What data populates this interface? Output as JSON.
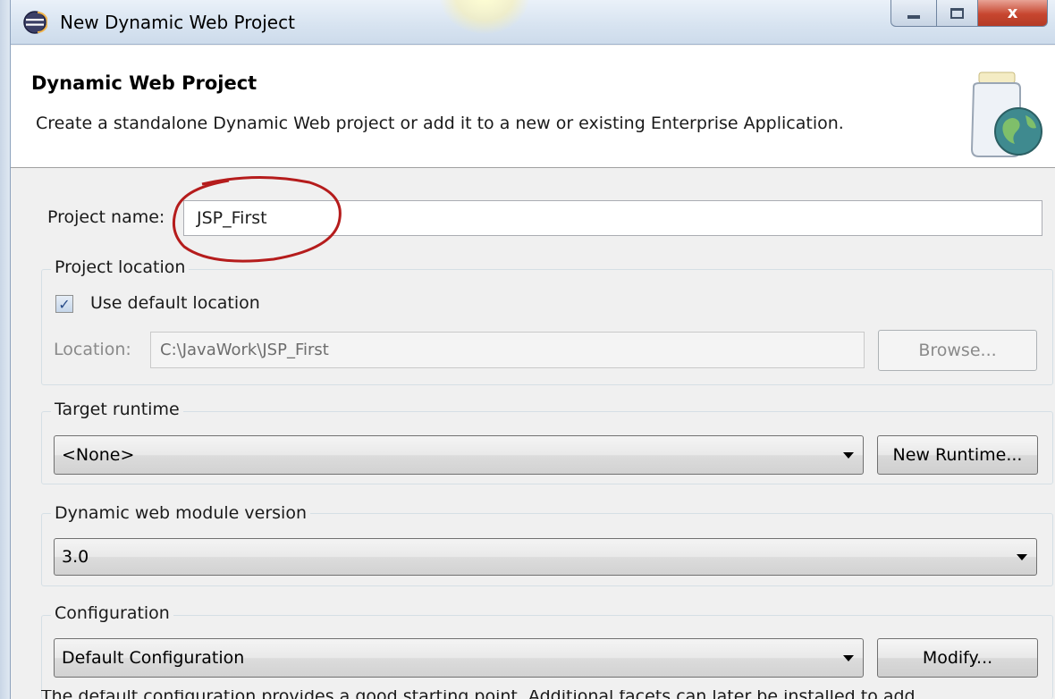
{
  "window": {
    "title": "New Dynamic Web Project",
    "controls": {
      "minimize": "minimize",
      "maximize": "maximize",
      "close": "x"
    }
  },
  "header": {
    "title": "Dynamic Web Project",
    "description": "Create a standalone Dynamic Web project or add it to a new or existing Enterprise Application."
  },
  "form": {
    "project_name_label": "Project name:",
    "project_name_value": "JSP_First",
    "project_location": {
      "group_title": "Project location",
      "use_default_label": "Use default location",
      "use_default_checked": true,
      "location_label": "Location:",
      "location_value": "C:\\JavaWork\\JSP_First",
      "browse_label": "Browse..."
    },
    "target_runtime": {
      "group_title": "Target runtime",
      "selected": "<None>",
      "new_runtime_label": "New Runtime..."
    },
    "module_version": {
      "group_title": "Dynamic web module version",
      "selected": "3.0"
    },
    "configuration": {
      "group_title": "Configuration",
      "selected": "Default Configuration",
      "modify_label": "Modify...",
      "description_partial": "The default configuration provides a good starting point. Additional facets can later be installed to add"
    }
  },
  "annotation": {
    "ellipse_color": "#b51c1c"
  },
  "colors": {
    "title_bar": "#d8e4f1",
    "dialog_bg": "#f0f0f0",
    "close_button": "#c7462f"
  }
}
